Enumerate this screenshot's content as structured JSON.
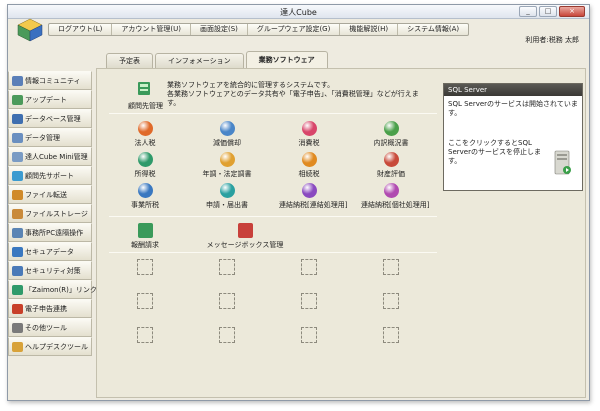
{
  "window": {
    "title": "達人Cube",
    "buttons": [
      "_",
      "□",
      "×"
    ]
  },
  "menubar": [
    "ログアウト(L)",
    "アカウント管理(U)",
    "画面設定(S)",
    "グループウェア設定(G)",
    "機能解説(H)",
    "システム情報(A)"
  ],
  "user": {
    "label": "利用者:税務 太郎"
  },
  "sidebar": [
    {
      "label": "情報コミュニティ",
      "color": "#5a7fb8"
    },
    {
      "label": "アップデート",
      "color": "#4c9a5b"
    },
    {
      "label": "データベース管理",
      "color": "#3f6fb0"
    },
    {
      "label": "データ管理",
      "color": "#6a8fc0"
    },
    {
      "label": "達人Cube Mini管理",
      "color": "#7a9bc4"
    },
    {
      "label": "顧問先サポート",
      "color": "#3c9bd0"
    },
    {
      "label": "ファイル転送",
      "color": "#d08a2a"
    },
    {
      "label": "ファイルストレージ",
      "color": "#c98a3a"
    },
    {
      "label": "事務所PC遠隔操作",
      "color": "#5a84b4"
    },
    {
      "label": "セキュアデータ",
      "color": "#3a78c0"
    },
    {
      "label": "セキュリティ対策",
      "color": "#4a7ab8"
    },
    {
      "label": "「Zaimon(R)」リンク",
      "color": "#2f9a6a"
    },
    {
      "label": "電子申告連携",
      "color": "#c8402a"
    },
    {
      "label": "その他ツール",
      "color": "#7a7a7a"
    },
    {
      "label": "ヘルプデスクツール",
      "color": "#d8a23a"
    }
  ],
  "tabs": [
    {
      "label": "予定表",
      "active": false
    },
    {
      "label": "インフォメーション",
      "active": false
    },
    {
      "label": "業務ソフトウェア",
      "active": true
    }
  ],
  "intro": {
    "icon_label": "顧問先管理",
    "text_1": "業務ソフトウェアを統合的に管理するシステムです。",
    "text_2": "各業務ソフトウェアとのデータ共有や「電子申告」、「消費税管理」などが行えます。"
  },
  "apps": [
    {
      "label": "法人税",
      "color": "#e06a2a"
    },
    {
      "label": "減価償却",
      "color": "#4a86c8"
    },
    {
      "label": "消費税",
      "color": "#d8456a"
    },
    {
      "label": "内訳概況書",
      "color": "#4aa04a"
    },
    {
      "label": "所得税",
      "color": "#2f9a6a"
    },
    {
      "label": "年調・法定調書",
      "color": "#e0a030"
    },
    {
      "label": "相続税",
      "color": "#e08a20"
    },
    {
      "label": "財産評価",
      "color": "#c84a3a"
    },
    {
      "label": "事業所税",
      "color": "#3a78c0"
    },
    {
      "label": "申請・届出書",
      "color": "#2aa0a0"
    },
    {
      "label": "連結納税[連結処理用]",
      "color": "#8a4ac0"
    },
    {
      "label": "連結納税[個社処理用]",
      "color": "#b04ab0"
    }
  ],
  "tools": [
    {
      "label": "報酬請求",
      "color": "#3a9a5a"
    },
    {
      "label": "メッセージボックス管理",
      "color": "#c8403a"
    }
  ],
  "sql_panel": {
    "title": "SQL Server",
    "status": "SQL Serverのサービスは開始されています。",
    "action": "ここをクリックするとSQL Serverのサービスを停止します。"
  }
}
